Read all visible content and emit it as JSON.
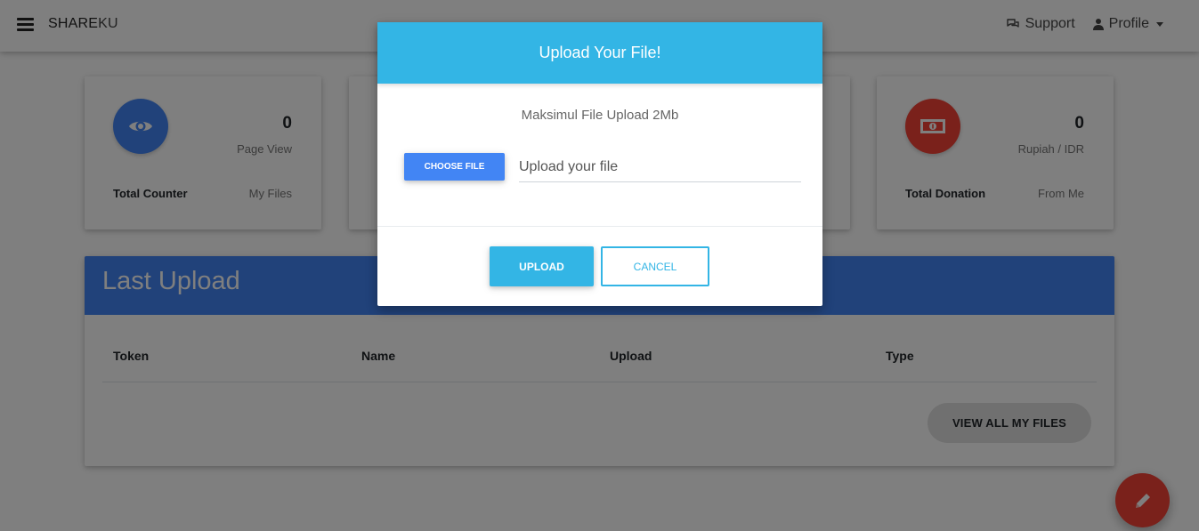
{
  "navbar": {
    "brand_bold": "SHARE",
    "brand_light": "KU",
    "support_label": "Support",
    "profile_label": "Profile"
  },
  "stats": {
    "counter": {
      "value": "0",
      "unit": "Page View",
      "title": "Total Counter",
      "sub": "My Files",
      "icon": "eye-icon",
      "color": "#4285f4"
    },
    "donation": {
      "value": "0",
      "unit": "Rupiah / IDR",
      "title": "Total Donation",
      "sub": "From Me",
      "icon": "money-icon",
      "color": "#f44336"
    }
  },
  "last_upload": {
    "title": "Last Upload",
    "columns": [
      "Token",
      "Name",
      "Upload",
      "Type"
    ],
    "view_all_label": "VIEW ALL MY FILES"
  },
  "modal": {
    "title": "Upload Your File!",
    "note": "Maksimul File Upload 2Mb",
    "choose_label": "CHOOSE FILE",
    "file_placeholder": "Upload your file",
    "upload_label": "UPLOAD",
    "cancel_label": "CANCEL"
  },
  "colors": {
    "primary": "#4285f4",
    "info": "#33b5e5",
    "danger": "#f44336"
  }
}
